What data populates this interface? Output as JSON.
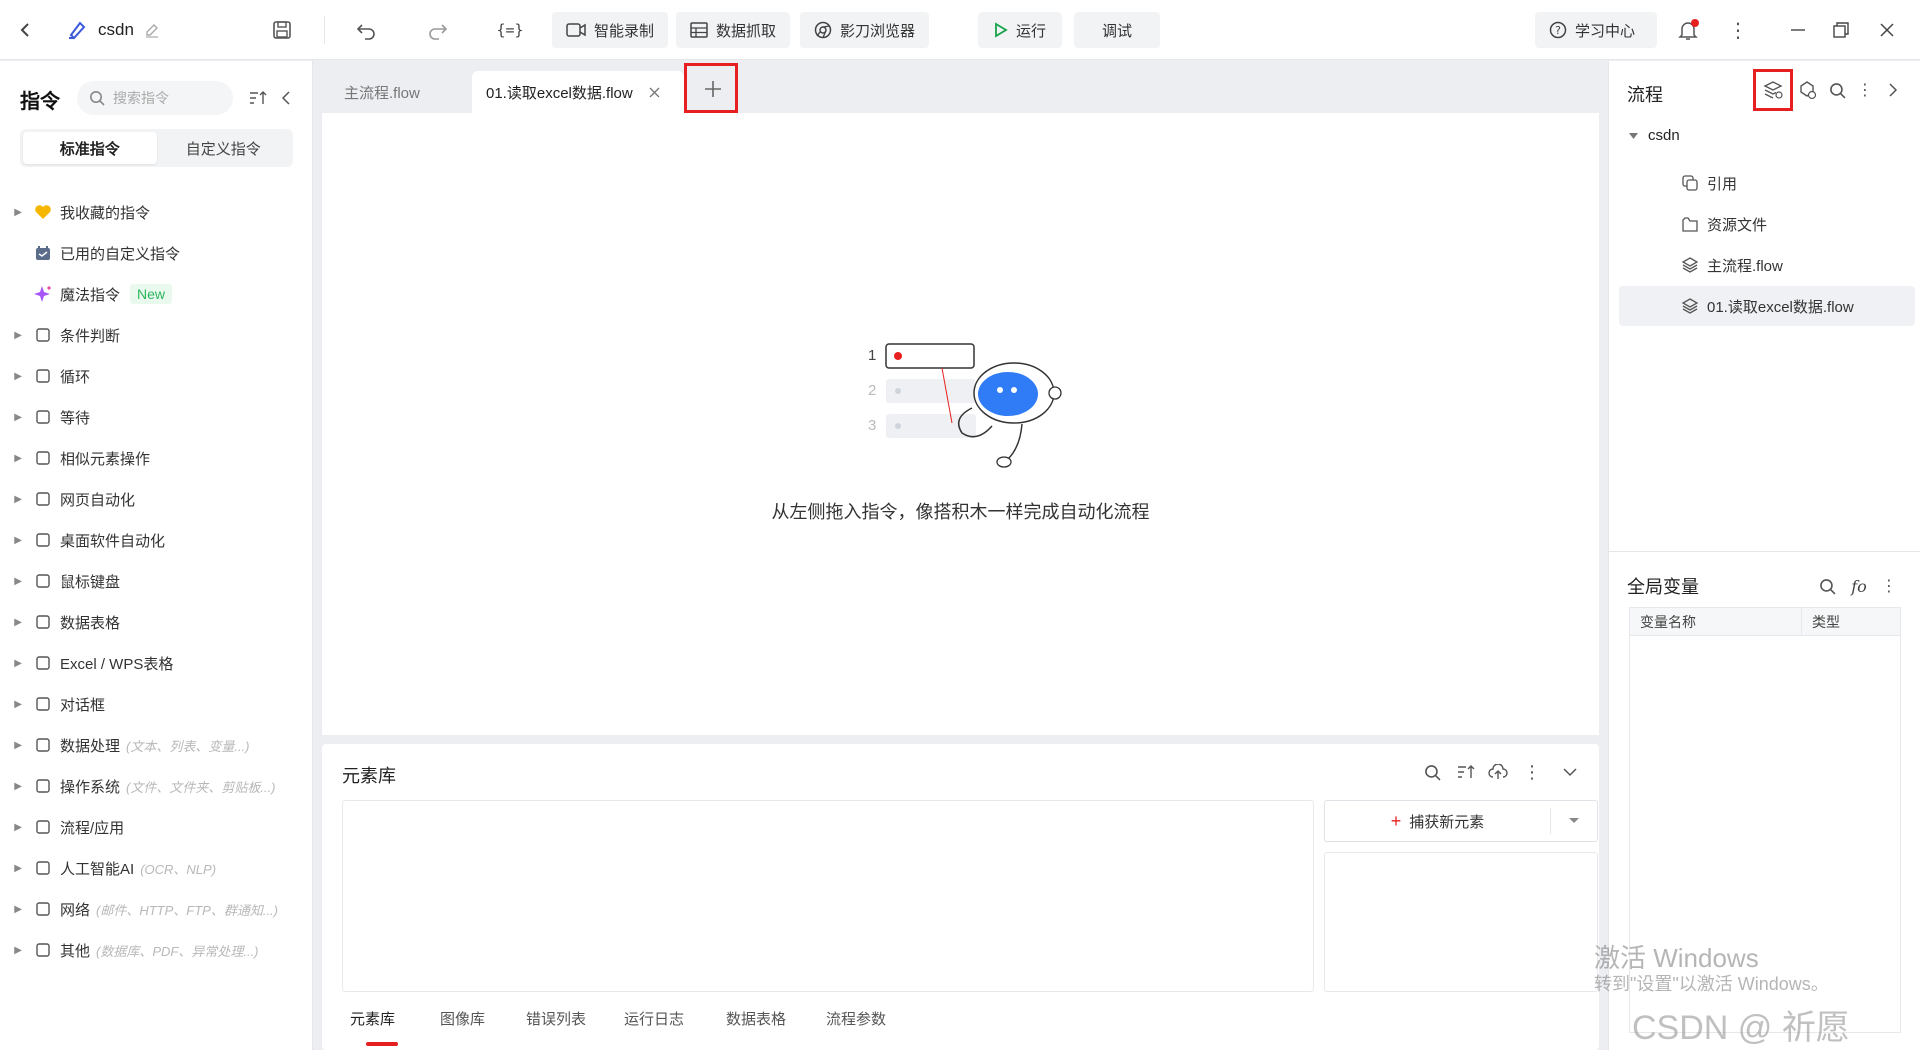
{
  "topbar": {
    "project_name": "csdn",
    "buttons": {
      "smart_record": "智能录制",
      "data_grab": "数据抓取",
      "browser": "影刀浏览器",
      "run": "运行",
      "debug": "调试",
      "learning": "学习中心"
    },
    "icons": [
      "back-icon",
      "project-icon",
      "edit-icon",
      "save-icon",
      "undo-icon",
      "redo-icon",
      "variable-icon",
      "video-icon",
      "table-icon",
      "browser-icon",
      "play-icon",
      "help-icon",
      "bell-icon",
      "more-icon",
      "minimize-icon",
      "restore-icon",
      "close-icon"
    ]
  },
  "left": {
    "title": "指令",
    "search_placeholder": "搜索指令",
    "tabs": [
      "标准指令",
      "自定义指令"
    ],
    "active_tab": 0,
    "items": [
      {
        "label": "我收藏的指令",
        "icon": "heart-icon",
        "arrow": true,
        "hint": ""
      },
      {
        "label": "已用的自定义指令",
        "icon": "calendar-icon",
        "arrow": false,
        "hint": ""
      },
      {
        "label": "魔法指令",
        "icon": "sparkle-icon",
        "arrow": false,
        "hint": "",
        "badge": "New"
      },
      {
        "label": "条件判断",
        "icon": "branch-icon",
        "arrow": true,
        "hint": ""
      },
      {
        "label": "循环",
        "icon": "loop-icon",
        "arrow": true,
        "hint": ""
      },
      {
        "label": "等待",
        "icon": "hourglass-icon",
        "arrow": true,
        "hint": ""
      },
      {
        "label": "相似元素操作",
        "icon": "copy-icon",
        "arrow": true,
        "hint": ""
      },
      {
        "label": "网页自动化",
        "icon": "browser-icon",
        "arrow": true,
        "hint": ""
      },
      {
        "label": "桌面软件自动化",
        "icon": "monitor-icon",
        "arrow": true,
        "hint": ""
      },
      {
        "label": "鼠标键盘",
        "icon": "cursor-icon",
        "arrow": true,
        "hint": ""
      },
      {
        "label": "数据表格",
        "icon": "document-icon",
        "arrow": true,
        "hint": ""
      },
      {
        "label": "Excel / WPS表格",
        "icon": "excel-icon",
        "arrow": true,
        "hint": ""
      },
      {
        "label": "对话框",
        "icon": "dialog-icon",
        "arrow": true,
        "hint": ""
      },
      {
        "label": "数据处理",
        "icon": "data-process-icon",
        "arrow": true,
        "hint": "(文本、列表、变量...)"
      },
      {
        "label": "操作系统",
        "icon": "briefcase-icon",
        "arrow": true,
        "hint": "(文件、文件夹、剪贴板...)"
      },
      {
        "label": "流程/应用",
        "icon": "layers-icon",
        "arrow": true,
        "hint": ""
      },
      {
        "label": "人工智能AI",
        "icon": "ai-icon",
        "arrow": true,
        "hint": "(OCR、NLP)"
      },
      {
        "label": "网络",
        "icon": "share-icon",
        "arrow": true,
        "hint": "(邮件、HTTP、FTP、群通知...)"
      },
      {
        "label": "其他",
        "icon": "grid-icon",
        "arrow": true,
        "hint": "(数据库、PDF、异常处理...)"
      }
    ]
  },
  "tabs": [
    {
      "label": "主流程.flow",
      "active": false
    },
    {
      "label": "01.读取excel数据.flow",
      "active": true
    }
  ],
  "canvas": {
    "empty_hint": "从左侧拖入指令，像搭积木一样完成自动化流程",
    "steps": [
      "1",
      "2",
      "3"
    ]
  },
  "library": {
    "title": "元素库",
    "capture_button": "捕获新元素",
    "bottom_tabs": [
      "元素库",
      "图像库",
      "错误列表",
      "运行日志",
      "数据表格",
      "流程参数"
    ],
    "active_bottom_tab": 0
  },
  "right": {
    "flow_title": "流程",
    "tree_root": "csdn",
    "tree_items": [
      {
        "label": "引用",
        "icon": "reference-icon"
      },
      {
        "label": "资源文件",
        "icon": "folder-icon"
      },
      {
        "label": "主流程.flow",
        "icon": "layers-icon"
      },
      {
        "label": "01.读取excel数据.flow",
        "icon": "layers-icon"
      }
    ],
    "selected_item": 3,
    "globals_title": "全局变量",
    "columns": [
      "变量名称",
      "类型"
    ]
  },
  "watermark": {
    "activate_title": "激活 Windows",
    "activate_sub": "转到\"设置\"以激活 Windows。",
    "csdn": "CSDN @  祈愿"
  },
  "colors": {
    "accent": "#2f6ef5",
    "highlight_red": "#e62020",
    "run_green": "#17a34a"
  }
}
